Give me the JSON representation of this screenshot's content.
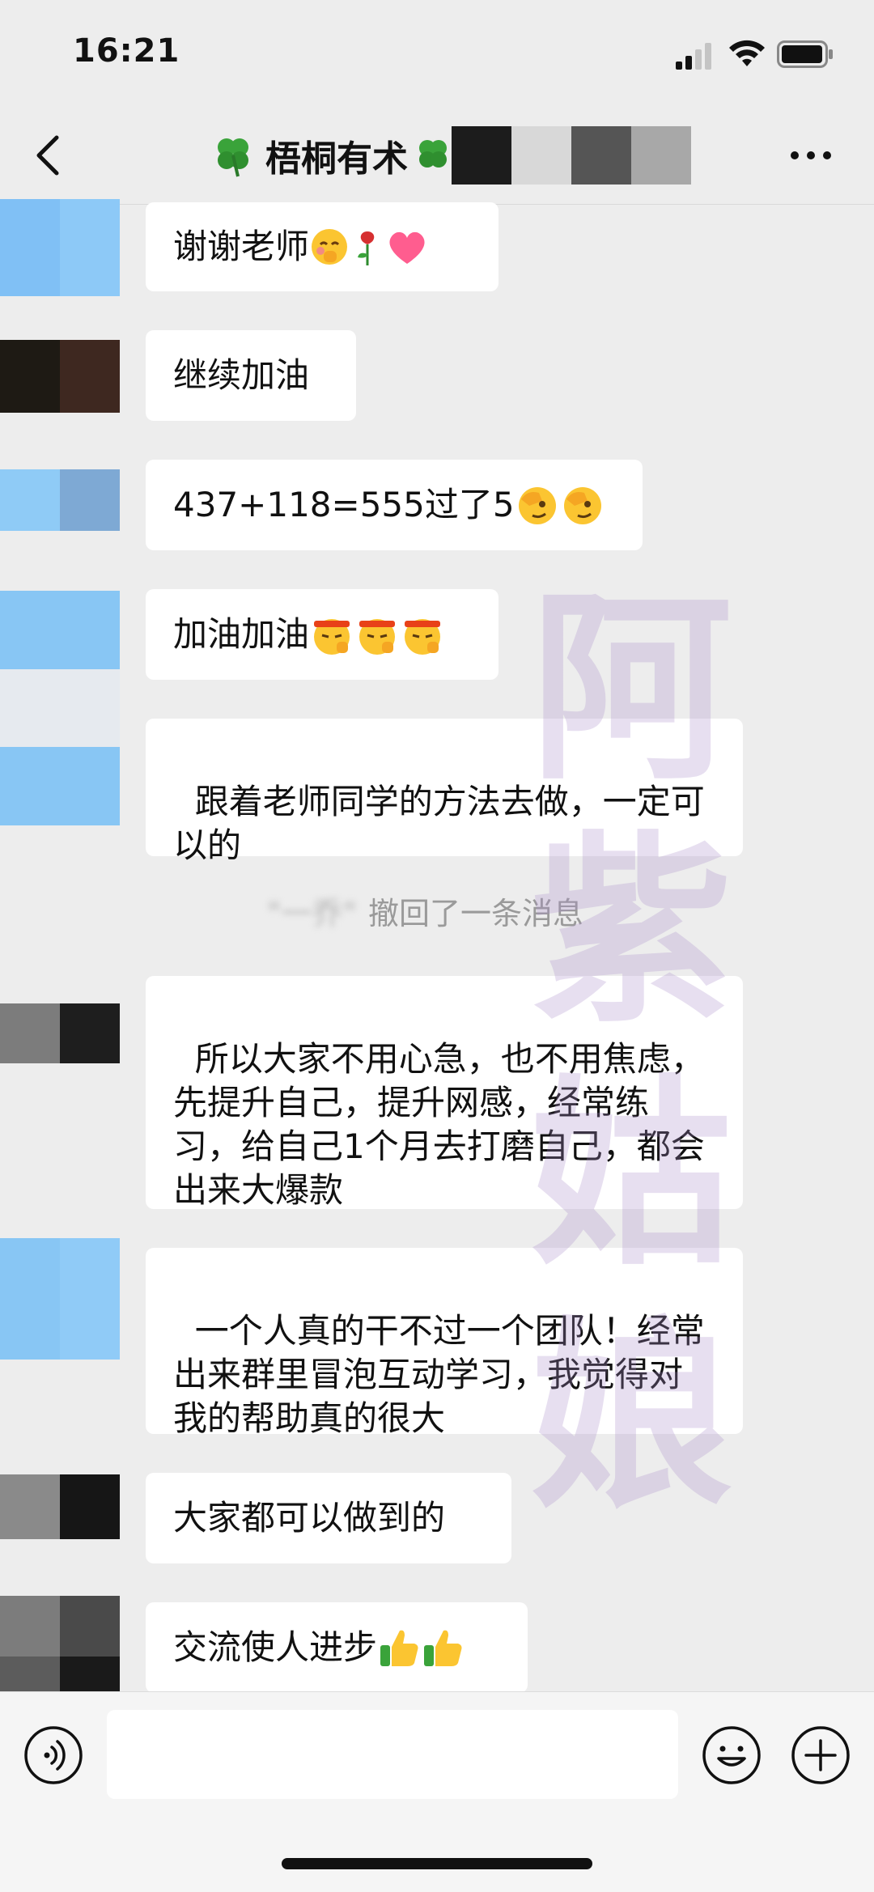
{
  "status_bar": {
    "time": "16:21"
  },
  "header": {
    "title": "梧桐有术",
    "title_icon": "clover-icon",
    "back_icon": "chevron-left-icon",
    "more_icon": "more-dots-icon"
  },
  "messages": [
    {
      "text": "谢谢老师",
      "emojis": [
        "shy-face-emoji",
        "rose-emoji",
        "heart-emoji"
      ]
    },
    {
      "text": "继续加油",
      "emojis": []
    },
    {
      "text": "437+118=555过了5",
      "emojis": [
        "facepalm-emoji",
        "facepalm-emoji"
      ]
    },
    {
      "text": "加油加油",
      "emojis": [
        "fighting-emoji",
        "fighting-emoji",
        "fighting-emoji"
      ]
    },
    {
      "text": "跟着老师同学的方法去做，一定可以的",
      "emojis": []
    },
    {
      "text": "所以大家不用心急，也不用焦虑，先提升自己，提升网感，经常练习，给自己1个月去打磨自己，都会出来大爆款",
      "emojis": []
    },
    {
      "text": "一个人真的干不过一个团队！经常出来群里冒泡互动学习，我觉得对我的帮助真的很大",
      "emojis": []
    },
    {
      "text": "大家都可以做到的",
      "emojis": []
    },
    {
      "text": "交流使人进步",
      "emojis": [
        "thumbs-up-emoji",
        "thumbs-up-emoji"
      ]
    }
  ],
  "recall_notice": {
    "name": "\"一乔\"",
    "text": "撤回了一条消息"
  },
  "watermark": "阿紫姑娘",
  "input_bar": {
    "voice_icon": "voice-icon",
    "emoji_icon": "emoji-face-icon",
    "plus_icon": "plus-circle-icon",
    "value": ""
  },
  "colors": {
    "background": "#ededed",
    "bubble": "#ffffff",
    "watermark": "#aa8cc8"
  }
}
